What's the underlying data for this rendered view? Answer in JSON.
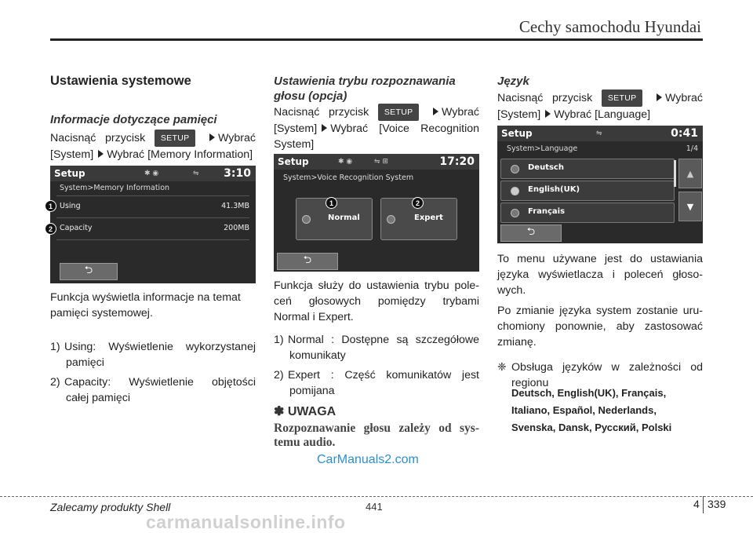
{
  "header": {
    "title": "Cechy samochodu Hyundai"
  },
  "col1": {
    "heading": "Ustawienia systemowe",
    "subheading": "Informacje dotyczące pamięci",
    "instr_a": "Nacisnąć przycisk",
    "setup_label": "SETUP",
    "instr_b": "Wybrać",
    "instr_c": "[System]",
    "instr_d": "Wybrać [Memory Information]",
    "screen": {
      "title": "Setup",
      "time": "3:10",
      "breadcrumb": "System>Memory Information",
      "rows": [
        {
          "label": "Using",
          "value": "41.3MB",
          "callout": "1"
        },
        {
          "label": "Capacity",
          "value": "200MB",
          "callout": "2"
        }
      ],
      "back_symbol": "⮌"
    },
    "desc": "Funkcja wyświetla informacje na temat pamięci systemowej.",
    "list": [
      {
        "num": "1)",
        "text1": "Using: Wyświetlenie wykorzystanej",
        "text2": "pamięci"
      },
      {
        "num": "2)",
        "text1": "Capacity: Wyświetlenie objętości",
        "text2": "całej pamięci"
      }
    ]
  },
  "col2": {
    "subheading1": "Ustawienia trybu rozpoznawania",
    "subheading2": "głosu (opcja)",
    "instr_a": "Nacisnąć przycisk",
    "setup_label": "SETUP",
    "instr_b": "Wybrać",
    "instr_c": "[System]",
    "instr_d": "Wybrać [Voice Recognition",
    "instr_e": "System]",
    "screen": {
      "title": "Setup",
      "time": "17:20",
      "breadcrumb": "System>Voice Recognition System",
      "options": [
        {
          "label": "Normal",
          "callout": "1"
        },
        {
          "label": "Expert",
          "callout": "2"
        }
      ],
      "back_symbol": "⮌"
    },
    "desc1": "Funkcja służy do ustawienia trybu pole-",
    "desc2": "ceń głosowych pomiędzy trybami",
    "desc3": "Normal i Expert.",
    "list": [
      {
        "num": "1)",
        "text1": "Normal : Dostępne są szczegółowe",
        "text2": "komunikaty"
      },
      {
        "num": "2)",
        "text1": "Expert : Część komunikatów jest",
        "text2": "pomijana"
      }
    ],
    "note_symbol": "✽",
    "note_title": "UWAGA",
    "note_body1": "Rozpoznawanie głosu zależy od sys-",
    "note_body2": "temu audio."
  },
  "col3": {
    "subheading": "Język",
    "instr_a": "Nacisnąć przycisk",
    "setup_label": "SETUP",
    "instr_b": "Wybrać",
    "instr_c": "[System]",
    "instr_d": "Wybrać [Language]",
    "screen": {
      "title": "Setup",
      "time": "0:41",
      "breadcrumb": "System>Language",
      "page": "1/4",
      "languages": [
        "Deutsch",
        "English(UK)",
        "Français"
      ],
      "back_symbol": "⮌"
    },
    "desc1_l1": "To menu używane jest do ustawiania",
    "desc1_l2": "języka wyświetlacza i poleceń głoso-",
    "desc1_l3": "wych.",
    "desc2_l1": "Po zmianie języka system zostanie uru-",
    "desc2_l2": "chomiony ponownie, aby zastosować",
    "desc2_l3": "zmianę.",
    "note_symbol": "❈",
    "note_l1": "Obsługa języków w zależności od",
    "note_l2": "regionu",
    "langs_l1": "Deutsch, English(UK), Français,",
    "langs_l2": "Italiano, Español, Nederlands,",
    "langs_l3": "Svenska, Dansk, Русский, Polski"
  },
  "watermark_site": "CarManuals2.com",
  "watermark_bottom": "carmanualsonline.info",
  "footer": {
    "left": "Zalecamy produkty Shell",
    "middle": "441",
    "right_section": "4",
    "right_page": "339"
  }
}
